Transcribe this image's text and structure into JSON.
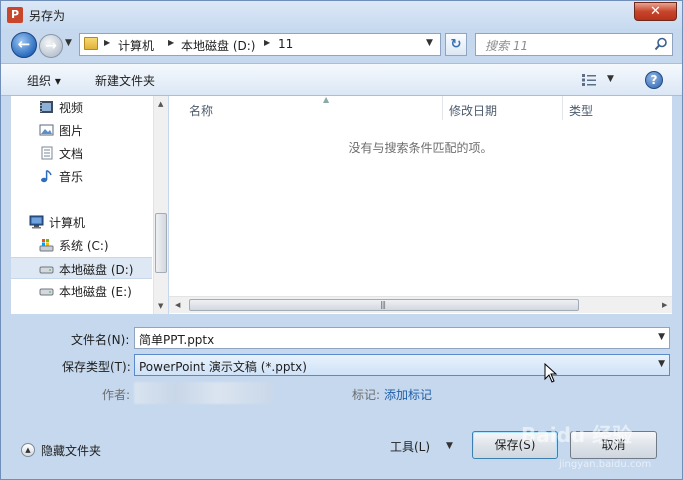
{
  "window": {
    "title": "另存为",
    "app_icon_letter": "P",
    "close_glyph": "✕"
  },
  "navigation": {
    "back_glyph": "←",
    "forward_glyph": "→",
    "breadcrumbs": [
      "计算机",
      "本地磁盘 (D:)",
      "11"
    ],
    "refresh_glyph": "↻"
  },
  "search": {
    "placeholder": "搜索 11"
  },
  "toolbar": {
    "organize_label": "组织 ▾",
    "new_folder_label": "新建文件夹"
  },
  "help_glyph": "?",
  "sidebar": {
    "items": [
      {
        "label": "视频",
        "icon": "video-icon"
      },
      {
        "label": "图片",
        "icon": "picture-icon"
      },
      {
        "label": "文档",
        "icon": "document-icon"
      },
      {
        "label": "音乐",
        "icon": "music-icon"
      },
      {
        "label": "计算机",
        "icon": "computer-icon"
      },
      {
        "label": "系统 (C:)",
        "icon": "system-drive-icon"
      },
      {
        "label": "本地磁盘 (D:)",
        "icon": "drive-icon",
        "selected": true
      },
      {
        "label": "本地磁盘 (E:)",
        "icon": "drive-icon"
      }
    ]
  },
  "file_list": {
    "columns": [
      "名称",
      "修改日期",
      "类型"
    ],
    "empty_message": "没有与搜索条件匹配的项。"
  },
  "form": {
    "filename_label": "文件名(N):",
    "filename_value": "简单PPT.pptx",
    "filetype_label": "保存类型(T):",
    "filetype_value": "PowerPoint 演示文稿 (*.pptx)",
    "author_label": "作者:",
    "tags_label": "标记:",
    "tags_link": "添加标记"
  },
  "footer": {
    "hide_folders_label": "隐藏文件夹",
    "tools_label": "工具(L)",
    "save_label": "保存(S)",
    "cancel_label": "取消"
  },
  "watermark": {
    "text": "Baidu 经验",
    "sub": "jingyan.baidu.com"
  },
  "colors": {
    "accent": "#1f5fa8",
    "title_bar": "#c7daf0",
    "close_button": "#c7452a",
    "selection": "#dde8f4"
  }
}
